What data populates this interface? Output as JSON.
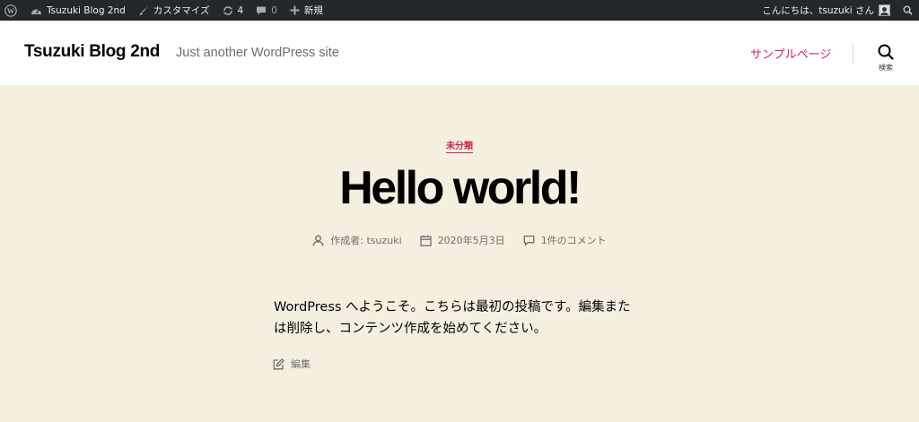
{
  "admin_bar": {
    "site_name": "Tsuzuki Blog 2nd",
    "customize": "カスタマイズ",
    "updates_count": "4",
    "comments_count": "0",
    "new_label": "新規",
    "greeting": "こんにちは、tsuzuki さん"
  },
  "header": {
    "site_title": "Tsuzuki Blog 2nd",
    "site_description": "Just another WordPress site",
    "nav_items": [
      {
        "label": "サンプルページ"
      }
    ],
    "search_label": "検索"
  },
  "post": {
    "category": "未分類",
    "title": "Hello world!",
    "author": "作成者: tsuzuki",
    "date": "2020年5月3日",
    "comments": "1件のコメント",
    "content": "WordPress へようこそ。こちらは最初の投稿です。編集または削除し、コンテンツ作成を始めてください。",
    "edit_label": "編集"
  },
  "colors": {
    "admin_bar_bg": "#23282d",
    "accent": "#cd2653",
    "page_bg": "#f5efe0"
  }
}
